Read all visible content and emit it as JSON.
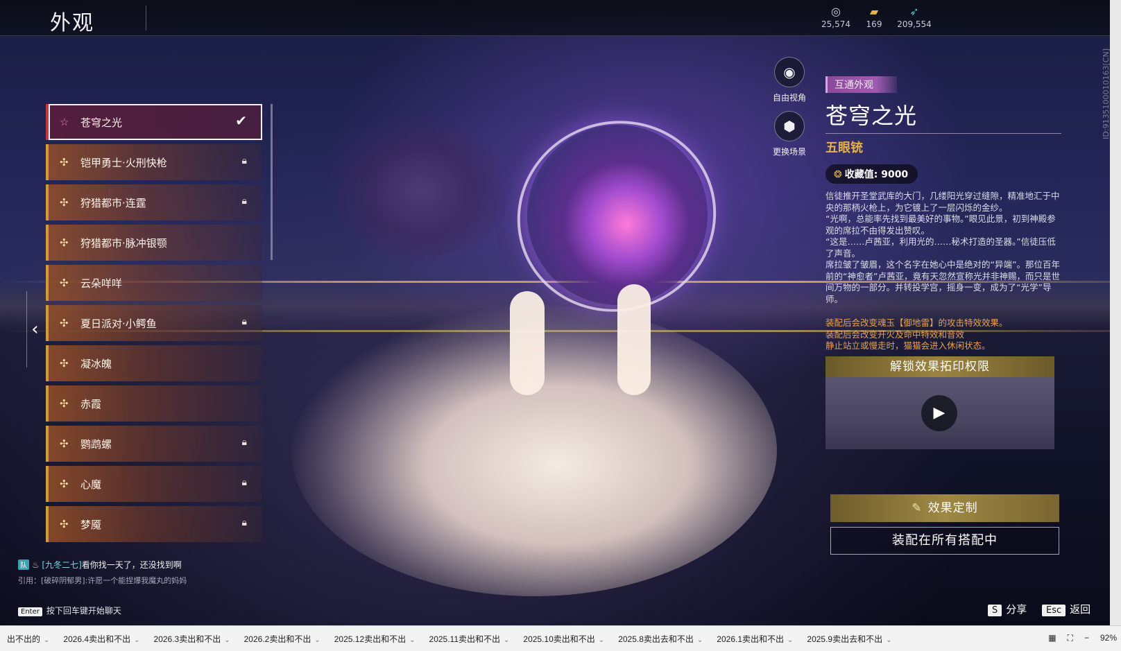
{
  "header": {
    "title": "外观",
    "currencies": [
      {
        "icon": "gem-currency-icon",
        "value": "25,574"
      },
      {
        "icon": "ticket-currency-icon",
        "value": "169"
      },
      {
        "icon": "feather-currency-icon",
        "value": "209,554"
      }
    ]
  },
  "appearance_list": [
    {
      "name": "苍穹之光",
      "selected": true,
      "locked": false
    },
    {
      "name": "铠甲勇士·火刑快枪",
      "selected": false,
      "locked": true
    },
    {
      "name": "狩猎都市·连霆",
      "selected": false,
      "locked": true
    },
    {
      "name": "狩猎都市·脉冲银颚",
      "selected": false,
      "locked": false
    },
    {
      "name": "云朵咩咩",
      "selected": false,
      "locked": false
    },
    {
      "name": "夏日派对·小鳄鱼",
      "selected": false,
      "locked": true
    },
    {
      "name": "凝冰魄",
      "selected": false,
      "locked": false
    },
    {
      "name": "赤霞",
      "selected": false,
      "locked": false
    },
    {
      "name": "鹦鹉螺",
      "selected": false,
      "locked": true
    },
    {
      "name": "心魔",
      "selected": false,
      "locked": true
    },
    {
      "name": "梦魇",
      "selected": false,
      "locked": true
    }
  ],
  "side_buttons": {
    "free_view": "自由视角",
    "change_scene": "更换场景"
  },
  "detail": {
    "tag": "互通外观",
    "title": "苍穹之光",
    "subtitle": "五眼铳",
    "collection_label": "收藏值: 9000",
    "description": [
      "信徒推开圣堂武库的大门，几缕阳光穿过缝隙，精准地汇于中央的那柄火枪上，为它镀上了一层闪烁的金纱。",
      "“光啊，总能率先找到最美好的事物。”眼见此景，初到神殿参观的席拉不由得发出赞叹。",
      "“这是……卢茜亚，利用光的……秘术打造的圣器。”信徒压低了声音。",
      "席拉皱了皱眉，这个名字在她心中是绝对的“异端”。那位百年前的“神愈者”卢茜亚，竟有天忽然宣称光并非神赐，而只是世间万物的一部分。并转投学宫，摇身一变，成为了“光学”导师。"
    ],
    "effects": [
      "装配后会改变魂玉【御地雷】的攻击特效效果。",
      "装配后会改变开火及命中特效和音效",
      "静止站立或慢走时，猫猫会进入休闲状态。"
    ],
    "unlock_label": "解锁效果拓印权限",
    "customize_label": "效果定制",
    "equip_label": "装配在所有搭配中"
  },
  "chat": {
    "badge": "队",
    "sender": "[九冬二七]",
    "message": "看你找一天了，还没找到啊",
    "quote": "引用：[破碎阴郁男]:许愿一个能捏爆我魔丸的妈妈",
    "hint_key": "Enter",
    "hint": "按下回车键开始聊天"
  },
  "bottom_actions": {
    "share_key": "S",
    "share_label": "分享",
    "back_key": "Esc",
    "back_label": "返回"
  },
  "id_text": "ID:9135100010163[CN]",
  "taskbar": {
    "tabs": [
      "出不出的",
      "2026.4卖出和不出",
      "2026.3卖出和不出",
      "2026.2卖出和不出",
      "2025.12卖出和不出",
      "2025.11卖出和不出",
      "2025.10卖出和不出",
      "2025.8卖出去和不出",
      "2026.1卖出和不出",
      "2025.9卖出去和不出"
    ],
    "zoom": "92%"
  },
  "colors": {
    "accent_gold": "#e6b24a",
    "tag_purple": "#a05bb0",
    "selected_border": "#c43a3a"
  }
}
